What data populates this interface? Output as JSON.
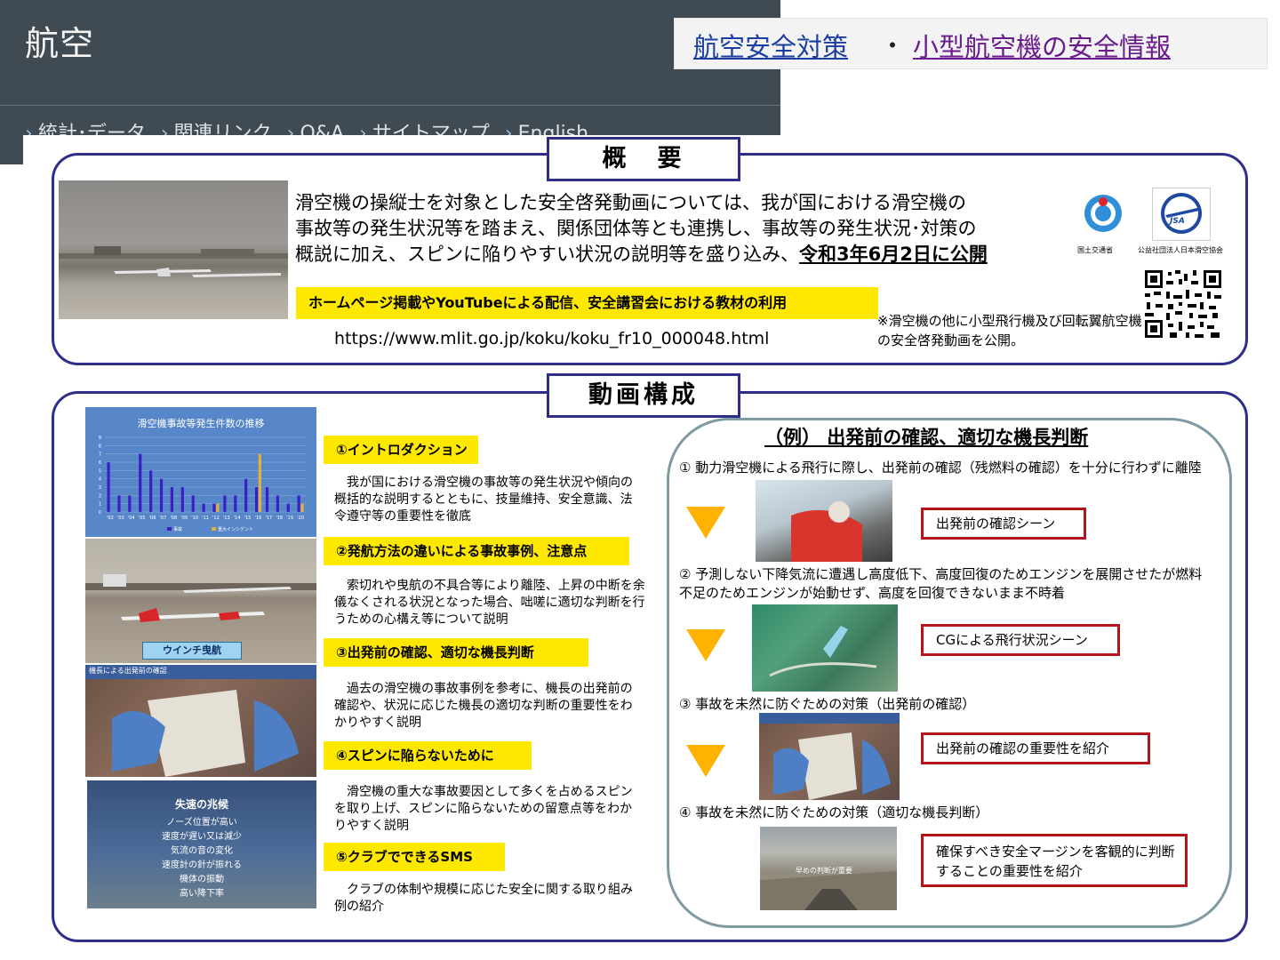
{
  "header": {
    "title": "航空",
    "nav": [
      "統計･データ",
      "関連リンク",
      "Q&A",
      "サイトマップ",
      "English"
    ],
    "links": {
      "safety": "航空安全対策",
      "separator": "・",
      "small_aircraft": "小型航空機の安全情報"
    }
  },
  "overview": {
    "title": "概　要",
    "text_lines": [
      "滑空機の操縦士を対象とした安全啓発動画については、我が国における滑空機の",
      "事故等の発生状況等を踏まえ、関係団体等とも連携し、事故等の発生状況･対策の"
    ],
    "text_line3_plain": "概説に加え、スピンに陥りやすい状況の説明等を盛り込み、",
    "text_line3_emph": "令和3年6月2日に公開",
    "distribution": "ホームページ掲載やYouTubeによる配信、安全講習会における教材の利用",
    "url": "https://www.mlit.go.jp/koku/koku_fr10_000048.html",
    "note": "※滑空機の他に小型飛行機及び回転翼航空機の安全啓発動画を公開。",
    "logo_mlit_label": "国土交通省",
    "logo_jsa_label": "公益社団法人日本滑空協会",
    "logo_jsa_text": "JSA"
  },
  "composition": {
    "title": "動画構成",
    "sections": [
      {
        "tag": "①イントロダクション",
        "text": "我が国における滑空機の事故等の発生状況や傾向の概括的な説明するとともに、技量維持、安全意識、法令遵守等の重要性を徹底"
      },
      {
        "tag": "②発航方法の違いによる事故事例、注意点",
        "text": "索切れや曳航の不具合等により離陸、上昇の中断を余儀なくされる状況となった場合、咄嗟に適切な判断を行うための心構え等について説明"
      },
      {
        "tag": "③出発前の確認、適切な機長判断",
        "text": "過去の滑空機の事故事例を参考に、機長の出発前の確認や、状況に応じた機長の適切な判断の重要性をわかりやすく説明"
      },
      {
        "tag": "④スピンに陥らないために",
        "text": "滑空機の重大な事故要因として多くを占めるスピンを取り上げ、スピンに陥らないための留意点等をわかりやすく説明"
      },
      {
        "tag": "⑤クラブでできるSMS",
        "text": "クラブの体制や規模に応じた安全に関する取り組み例の紹介"
      }
    ],
    "winch_label": "ウインチ曳航",
    "captain_check_label": "機長による出発前の確認",
    "spin_title": "失速の兆候",
    "spin_items": [
      "ノーズ位置が高い",
      "速度が遅い又は減少",
      "気流の音の変化",
      "速度計の針が振れる",
      "機体の振動",
      "高い降下率"
    ]
  },
  "example": {
    "title": "（例） 出発前の確認、適切な機長判断",
    "steps": [
      {
        "text": "①  動力滑空機による飛行に際し、出発前の確認（残燃料の確認）を十分に行わずに離陸",
        "box": "出発前の確認シーン"
      },
      {
        "text": "②  予測しない下降気流に遭遇し高度低下、高度回復のためエンジンを展開させたが燃料不足のためエンジンが始動せず、高度を回復できないまま不時着",
        "box": "CGによる飛行状況シーン"
      },
      {
        "text": "③  事故を未然に防ぐための対策（出発前の確認）",
        "box": "出発前の確認の重要性を紹介"
      },
      {
        "text": "④  事故を未然に防ぐための対策（適切な機長判断）",
        "box": "確保すべき安全マージンを客観的に判断することの重要性を紹介"
      }
    ],
    "early_decision_label": "早めの判断が重要"
  },
  "colors": {
    "frame": "#2e2e8a",
    "highlight": "#ffe800",
    "red_box": "#b4151c",
    "arrow": "#ffb300",
    "header_bg": "#3f4a52"
  },
  "chart_data": {
    "type": "bar",
    "title": "滑空機事故等発生件数の推移",
    "categories": [
      "'02",
      "'03",
      "'04",
      "'05",
      "'06",
      "'07",
      "'08",
      "'09",
      "'10",
      "'11",
      "'12",
      "'13",
      "'14",
      "'15",
      "'16",
      "'17",
      "'18",
      "'19",
      "'20"
    ],
    "series": [
      {
        "name": "事故",
        "values": [
          6,
          2,
          2,
          7,
          5,
          4,
          3,
          3,
          2,
          1,
          1,
          2,
          2,
          4,
          3,
          3,
          2,
          1,
          2
        ]
      },
      {
        "name": "重大インシデント",
        "values": [
          0,
          0,
          0,
          0,
          0,
          0,
          0,
          0,
          0,
          0,
          1,
          0,
          0,
          0,
          7,
          0,
          0,
          0,
          1
        ]
      }
    ],
    "ylim": [
      0,
      9
    ],
    "yticks": [
      0,
      1,
      2,
      3,
      4,
      5,
      6,
      7,
      8,
      9
    ],
    "legend_position": "bottom"
  }
}
